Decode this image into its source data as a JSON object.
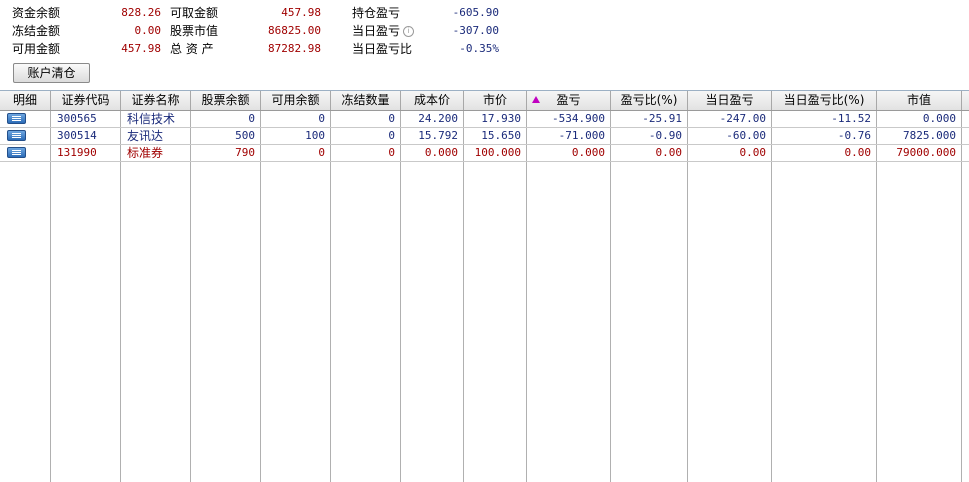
{
  "summary": {
    "col1": [
      {
        "label": "资金余额",
        "value": "828.26"
      },
      {
        "label": "冻结金额",
        "value": "0.00"
      },
      {
        "label": "可用金额",
        "value": "457.98"
      }
    ],
    "col2": [
      {
        "label": "可取金额",
        "value": "457.98"
      },
      {
        "label": "股票市值",
        "value": "86825.00"
      },
      {
        "label": "总 资 产",
        "value": "87282.98"
      }
    ],
    "col3": [
      {
        "label": "持仓盈亏",
        "value": "-605.90"
      },
      {
        "label": "当日盈亏",
        "value": "-307.00"
      },
      {
        "label": "当日盈亏比",
        "value": "-0.35%"
      }
    ],
    "info_icon": "info-circle-icon",
    "clear_button": "账户清仓"
  },
  "table": {
    "sorted_column": "盈亏",
    "sort_direction": "ascending",
    "sort_icon_color": "#c000c0",
    "headers": [
      "明细",
      "证券代码",
      "证券名称",
      "股票余额",
      "可用余额",
      "冻结数量",
      "成本价",
      "市价",
      "盈亏",
      "盈亏比(%)",
      "当日盈亏",
      "当日盈亏比(%)",
      "市值"
    ],
    "rows": [
      {
        "code": "300565",
        "name": "科信技术",
        "balance": "0",
        "available": "0",
        "frozen": "0",
        "cost": "24.200",
        "price": "17.930",
        "pnl": "-534.900",
        "pnl_pct": "-25.91",
        "day_pnl": "-247.00",
        "day_pnl_pct": "-11.52",
        "market_value": "0.000",
        "color": "navy"
      },
      {
        "code": "300514",
        "name": "友讯达",
        "balance": "500",
        "available": "100",
        "frozen": "0",
        "cost": "15.792",
        "price": "15.650",
        "pnl": "-71.000",
        "pnl_pct": "-0.90",
        "day_pnl": "-60.00",
        "day_pnl_pct": "-0.76",
        "market_value": "7825.000",
        "color": "navy"
      },
      {
        "code": "131990",
        "name": "标准券",
        "balance": "790",
        "available": "0",
        "frozen": "0",
        "cost": "0.000",
        "price": "100.000",
        "pnl": "0.000",
        "pnl_pct": "0.00",
        "day_pnl": "0.00",
        "day_pnl_pct": "0.00",
        "market_value": "79000.000",
        "color": "red"
      }
    ],
    "detail_icon": "list-detail-icon"
  },
  "colors": {
    "negative": "#1a2a7a",
    "positive": "#a00000",
    "header_bg": "#e6e6e6"
  }
}
